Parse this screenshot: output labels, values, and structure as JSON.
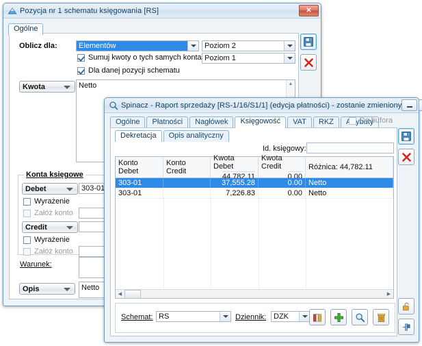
{
  "window1": {
    "title": "Pozycja nr 1 schematu księgowania [RS]",
    "icon": "blue-triangle-icon",
    "close_label": "✕",
    "tabs": [
      {
        "label": "Ogólne",
        "active": true
      }
    ],
    "oblicz_label": "Oblicz dla:",
    "oblicz_value": "Elementów",
    "poziom2": "Poziom 2",
    "poziom1": "Poziom 1",
    "check_sumuj": "Sumuj kwoty o tych samych kontach",
    "check_dla_danej": "Dla danej pozycji schematu",
    "kwota_label": "Kwota",
    "kwota_value": "Netto",
    "konta_group": "Konta księgowe",
    "debet_label": "Debet",
    "debet_value": "303-01",
    "credit_label": "Credit",
    "credit_value": "",
    "wyrazenie_label": "Wyrażenie",
    "zaloz_konto_label": "Załóż konto",
    "warunek_label": "Warunek:",
    "warunek_value": "",
    "opis_label": "Opis",
    "opis_value": "Netto",
    "side_buttons": [
      {
        "name": "save-button",
        "icon": "floppy-disk-icon"
      },
      {
        "name": "cancel-button",
        "icon": "red-x-icon"
      }
    ]
  },
  "window2": {
    "title": "Spinacz - Raport sprzedaży [RS-1/16/S1/1] (edycja płatności) - zostanie zmieniony",
    "icon": "magnifier-icon",
    "tabs": [
      {
        "label": "Ogólne",
        "active": false
      },
      {
        "label": "Płatności",
        "active": false
      },
      {
        "label": "Nagłówek",
        "active": false
      },
      {
        "label": "Księgowość",
        "active": true
      },
      {
        "label": "VAT",
        "active": false
      },
      {
        "label": "RKZ",
        "active": false
      },
      {
        "label": "Atrybuty",
        "active": false
      }
    ],
    "do_bufora_label": "Do bufora",
    "do_bufora_checked": false,
    "subtabs": [
      {
        "label": "Dekretacja",
        "active": true
      },
      {
        "label": "Opis analityczny",
        "active": false
      }
    ],
    "id_ksiegowy_label": "Id. księgowy:",
    "id_ksiegowy_value": "",
    "grid": {
      "columns": [
        "Konto Debet",
        "Konto Credit",
        "Kwota Debet",
        "Kwota Credit",
        "Różnica: 44,782.11"
      ],
      "sums": [
        "",
        "",
        "44,782.11",
        "0.00",
        ""
      ],
      "rows": [
        {
          "cells": [
            "303-01",
            "",
            "37,555.28",
            "0.00",
            "Netto"
          ],
          "selected": true
        },
        {
          "cells": [
            "303-01",
            "",
            "7,226.83",
            "0.00",
            "Netto"
          ],
          "selected": false
        }
      ]
    },
    "schemat_label": "Schemat:",
    "schemat_value": "RS",
    "dziennik_label": "Dziennik:",
    "dziennik_value": "DZK",
    "grid_buttons": [
      {
        "name": "journals-button",
        "icon": "books-icon"
      },
      {
        "name": "add-button",
        "icon": "green-plus-icon"
      },
      {
        "name": "preview-button",
        "icon": "magnifier-icon"
      },
      {
        "name": "delete-button",
        "icon": "trash-icon"
      }
    ],
    "side_buttons": [
      {
        "name": "save-button",
        "icon": "floppy-disk-icon"
      },
      {
        "name": "cancel-button",
        "icon": "red-x-icon"
      },
      {
        "name": "unlock-button",
        "icon": "padlock-open-icon"
      },
      {
        "name": "pin-button",
        "icon": "pin-icon"
      }
    ],
    "titlebar_buttons": [
      {
        "name": "minimize-button",
        "glyph": "—"
      },
      {
        "name": "maximize-button",
        "glyph": "▭"
      },
      {
        "name": "close-button",
        "glyph": "✕"
      }
    ]
  },
  "colors": {
    "selection": "#2e8ae6",
    "window_border": "#6d9dc5",
    "title_text": "#16435f"
  }
}
